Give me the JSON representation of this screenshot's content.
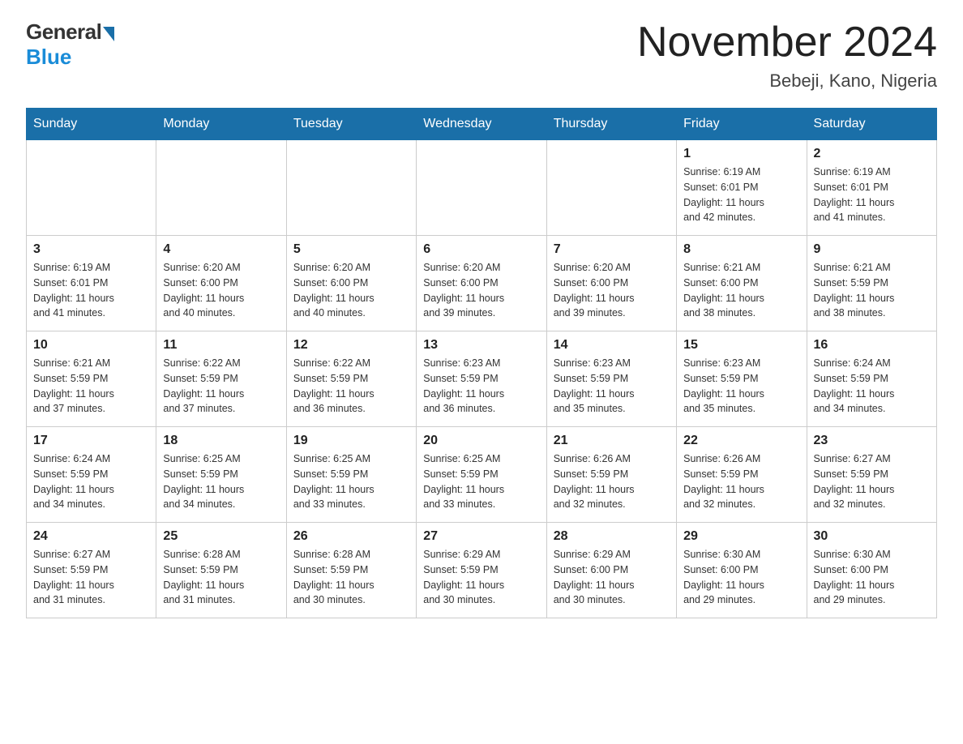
{
  "logo": {
    "general": "General",
    "blue": "Blue"
  },
  "header": {
    "title": "November 2024",
    "subtitle": "Bebeji, Kano, Nigeria"
  },
  "days_of_week": [
    "Sunday",
    "Monday",
    "Tuesday",
    "Wednesday",
    "Thursday",
    "Friday",
    "Saturday"
  ],
  "weeks": [
    [
      {
        "day": "",
        "info": ""
      },
      {
        "day": "",
        "info": ""
      },
      {
        "day": "",
        "info": ""
      },
      {
        "day": "",
        "info": ""
      },
      {
        "day": "",
        "info": ""
      },
      {
        "day": "1",
        "info": "Sunrise: 6:19 AM\nSunset: 6:01 PM\nDaylight: 11 hours\nand 42 minutes."
      },
      {
        "day": "2",
        "info": "Sunrise: 6:19 AM\nSunset: 6:01 PM\nDaylight: 11 hours\nand 41 minutes."
      }
    ],
    [
      {
        "day": "3",
        "info": "Sunrise: 6:19 AM\nSunset: 6:01 PM\nDaylight: 11 hours\nand 41 minutes."
      },
      {
        "day": "4",
        "info": "Sunrise: 6:20 AM\nSunset: 6:00 PM\nDaylight: 11 hours\nand 40 minutes."
      },
      {
        "day": "5",
        "info": "Sunrise: 6:20 AM\nSunset: 6:00 PM\nDaylight: 11 hours\nand 40 minutes."
      },
      {
        "day": "6",
        "info": "Sunrise: 6:20 AM\nSunset: 6:00 PM\nDaylight: 11 hours\nand 39 minutes."
      },
      {
        "day": "7",
        "info": "Sunrise: 6:20 AM\nSunset: 6:00 PM\nDaylight: 11 hours\nand 39 minutes."
      },
      {
        "day": "8",
        "info": "Sunrise: 6:21 AM\nSunset: 6:00 PM\nDaylight: 11 hours\nand 38 minutes."
      },
      {
        "day": "9",
        "info": "Sunrise: 6:21 AM\nSunset: 5:59 PM\nDaylight: 11 hours\nand 38 minutes."
      }
    ],
    [
      {
        "day": "10",
        "info": "Sunrise: 6:21 AM\nSunset: 5:59 PM\nDaylight: 11 hours\nand 37 minutes."
      },
      {
        "day": "11",
        "info": "Sunrise: 6:22 AM\nSunset: 5:59 PM\nDaylight: 11 hours\nand 37 minutes."
      },
      {
        "day": "12",
        "info": "Sunrise: 6:22 AM\nSunset: 5:59 PM\nDaylight: 11 hours\nand 36 minutes."
      },
      {
        "day": "13",
        "info": "Sunrise: 6:23 AM\nSunset: 5:59 PM\nDaylight: 11 hours\nand 36 minutes."
      },
      {
        "day": "14",
        "info": "Sunrise: 6:23 AM\nSunset: 5:59 PM\nDaylight: 11 hours\nand 35 minutes."
      },
      {
        "day": "15",
        "info": "Sunrise: 6:23 AM\nSunset: 5:59 PM\nDaylight: 11 hours\nand 35 minutes."
      },
      {
        "day": "16",
        "info": "Sunrise: 6:24 AM\nSunset: 5:59 PM\nDaylight: 11 hours\nand 34 minutes."
      }
    ],
    [
      {
        "day": "17",
        "info": "Sunrise: 6:24 AM\nSunset: 5:59 PM\nDaylight: 11 hours\nand 34 minutes."
      },
      {
        "day": "18",
        "info": "Sunrise: 6:25 AM\nSunset: 5:59 PM\nDaylight: 11 hours\nand 34 minutes."
      },
      {
        "day": "19",
        "info": "Sunrise: 6:25 AM\nSunset: 5:59 PM\nDaylight: 11 hours\nand 33 minutes."
      },
      {
        "day": "20",
        "info": "Sunrise: 6:25 AM\nSunset: 5:59 PM\nDaylight: 11 hours\nand 33 minutes."
      },
      {
        "day": "21",
        "info": "Sunrise: 6:26 AM\nSunset: 5:59 PM\nDaylight: 11 hours\nand 32 minutes."
      },
      {
        "day": "22",
        "info": "Sunrise: 6:26 AM\nSunset: 5:59 PM\nDaylight: 11 hours\nand 32 minutes."
      },
      {
        "day": "23",
        "info": "Sunrise: 6:27 AM\nSunset: 5:59 PM\nDaylight: 11 hours\nand 32 minutes."
      }
    ],
    [
      {
        "day": "24",
        "info": "Sunrise: 6:27 AM\nSunset: 5:59 PM\nDaylight: 11 hours\nand 31 minutes."
      },
      {
        "day": "25",
        "info": "Sunrise: 6:28 AM\nSunset: 5:59 PM\nDaylight: 11 hours\nand 31 minutes."
      },
      {
        "day": "26",
        "info": "Sunrise: 6:28 AM\nSunset: 5:59 PM\nDaylight: 11 hours\nand 30 minutes."
      },
      {
        "day": "27",
        "info": "Sunrise: 6:29 AM\nSunset: 5:59 PM\nDaylight: 11 hours\nand 30 minutes."
      },
      {
        "day": "28",
        "info": "Sunrise: 6:29 AM\nSunset: 6:00 PM\nDaylight: 11 hours\nand 30 minutes."
      },
      {
        "day": "29",
        "info": "Sunrise: 6:30 AM\nSunset: 6:00 PM\nDaylight: 11 hours\nand 29 minutes."
      },
      {
        "day": "30",
        "info": "Sunrise: 6:30 AM\nSunset: 6:00 PM\nDaylight: 11 hours\nand 29 minutes."
      }
    ]
  ]
}
